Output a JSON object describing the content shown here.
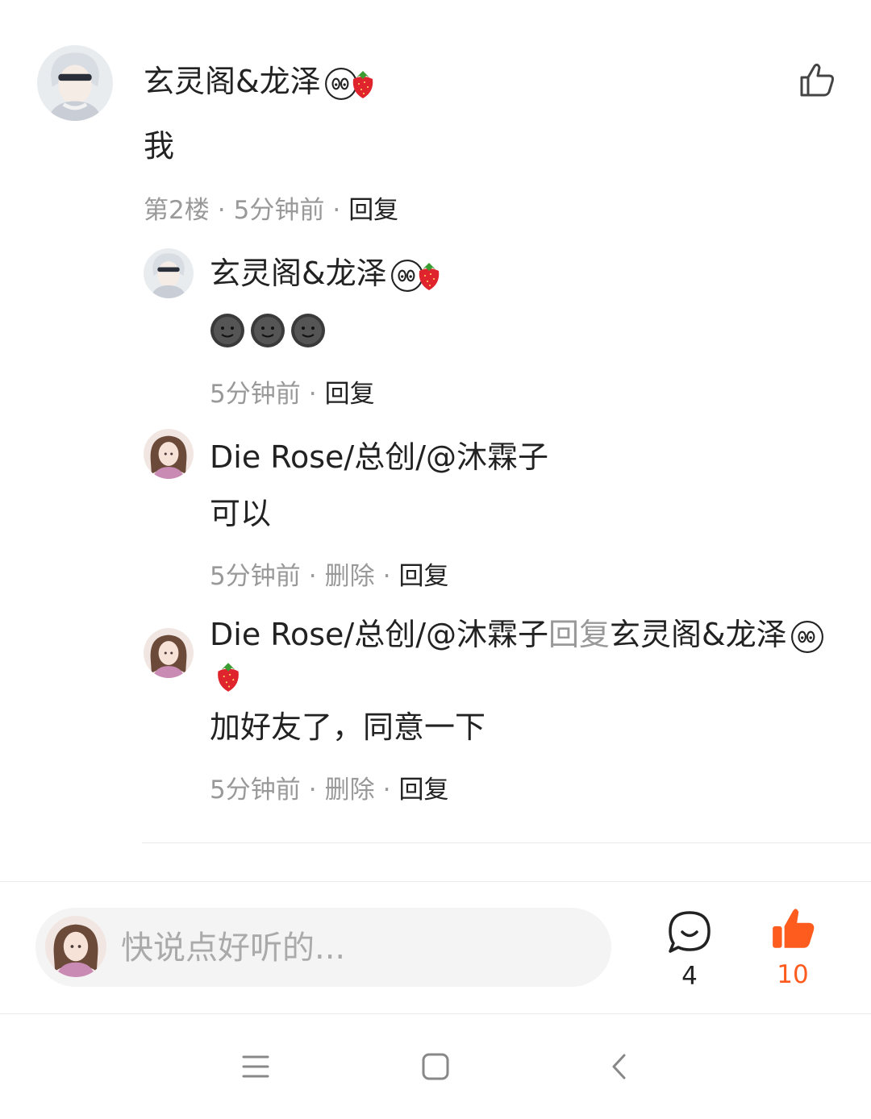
{
  "comment": {
    "author": "玄灵阁&龙泽",
    "text": "我",
    "meta": {
      "floor": "第2楼",
      "time": "5分钟前",
      "reply": "回复"
    }
  },
  "replies": [
    {
      "author": "玄灵阁&龙泽",
      "text": "🌚🌚🌚",
      "meta": {
        "time": "5分钟前",
        "reply": "回复"
      }
    },
    {
      "author": "Die Rose/总创/@沐霖子",
      "text": "可以",
      "meta": {
        "time": "5分钟前",
        "delete": "删除",
        "reply": "回复"
      }
    },
    {
      "author": "Die Rose/总创/@沐霖子",
      "reply_word": "回复",
      "reply_to": "玄灵阁&龙泽",
      "text": "加好友了，同意一下",
      "meta": {
        "time": "5分钟前",
        "delete": "删除",
        "reply": "回复"
      }
    }
  ],
  "bottom_bar": {
    "input_placeholder": "快说点好听的...",
    "comments_count": "4",
    "likes_count": "10"
  },
  "nav": {
    "icons": [
      "menu-icon",
      "home-icon",
      "back-icon"
    ]
  },
  "colors": {
    "accent": "#fe5b1f",
    "meta": "#999999",
    "text": "#222222"
  }
}
